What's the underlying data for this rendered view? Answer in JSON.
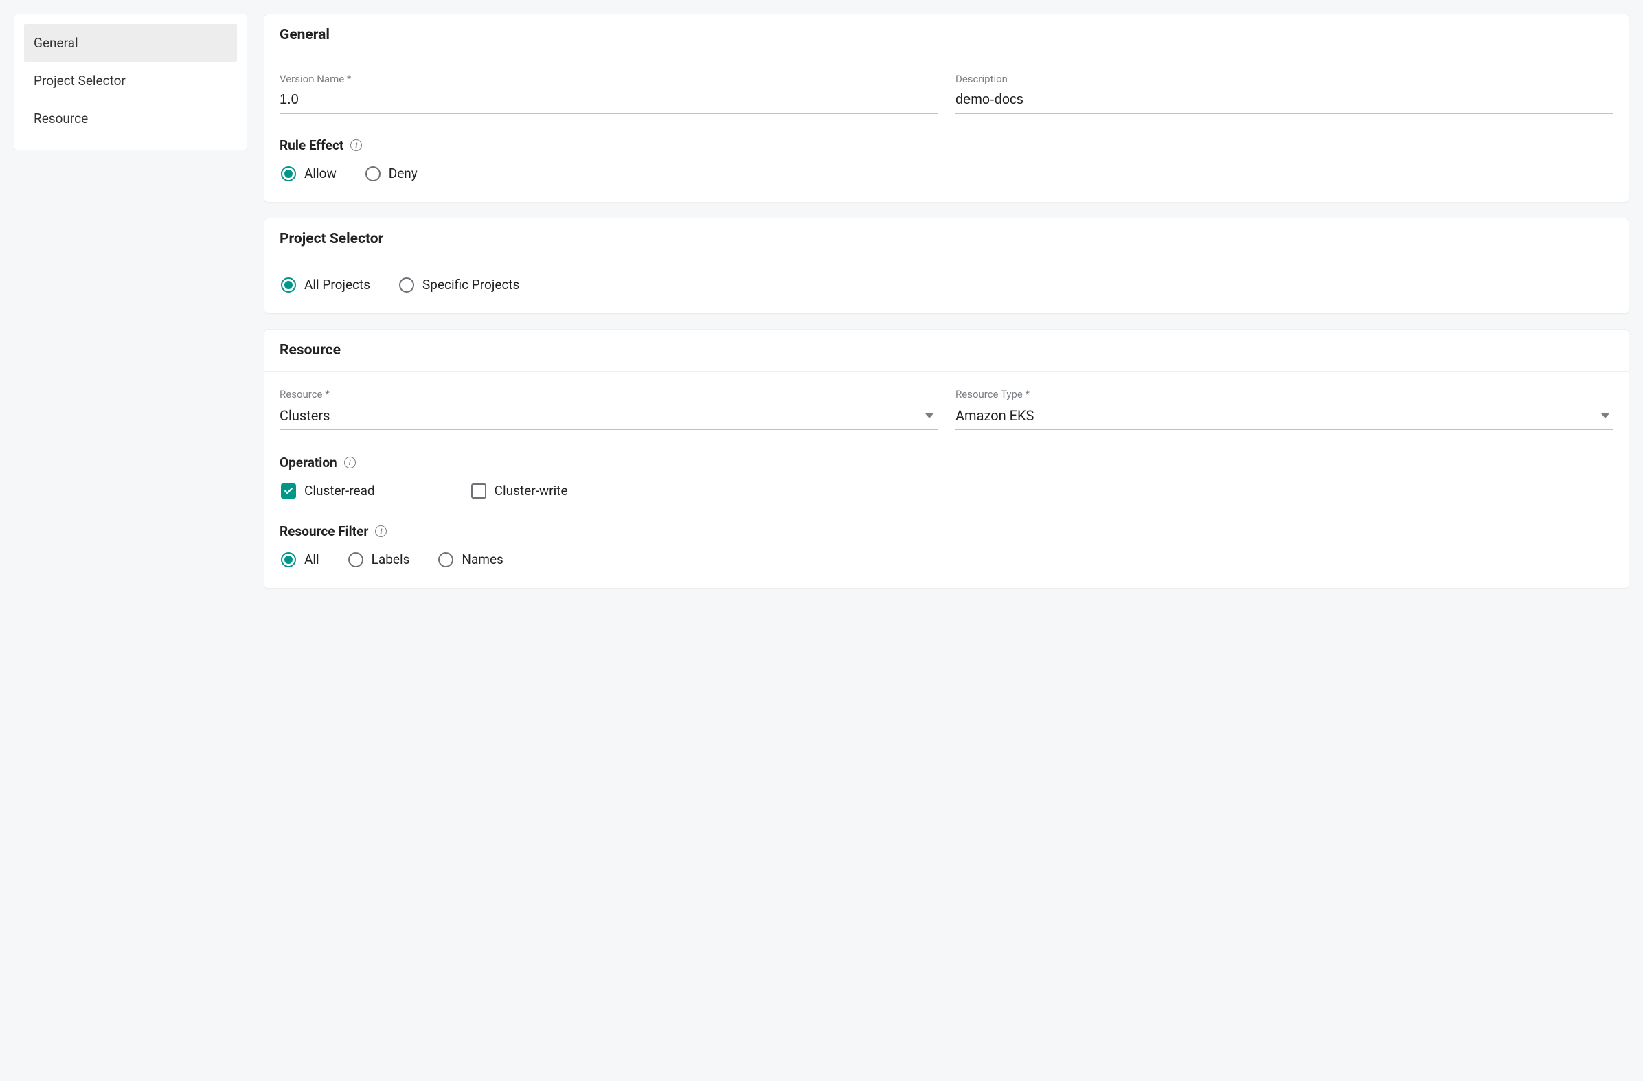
{
  "sidebar": {
    "items": [
      {
        "label": "General",
        "active": true
      },
      {
        "label": "Project Selector",
        "active": false
      },
      {
        "label": "Resource",
        "active": false
      }
    ]
  },
  "general": {
    "title": "General",
    "version_label": "Version Name *",
    "version_value": "1.0",
    "description_label": "Description",
    "description_value": "demo-docs",
    "rule_effect_heading": "Rule Effect",
    "allow_label": "Allow",
    "deny_label": "Deny"
  },
  "project_selector": {
    "title": "Project Selector",
    "all_label": "All Projects",
    "specific_label": "Specific Projects"
  },
  "resource": {
    "title": "Resource",
    "resource_label": "Resource *",
    "resource_value": "Clusters",
    "resource_type_label": "Resource Type *",
    "resource_type_value": "Amazon EKS",
    "operation_heading": "Operation",
    "cluster_read_label": "Cluster-read",
    "cluster_write_label": "Cluster-write",
    "resource_filter_heading": "Resource Filter",
    "filter_all_label": "All",
    "filter_labels_label": "Labels",
    "filter_names_label": "Names"
  }
}
